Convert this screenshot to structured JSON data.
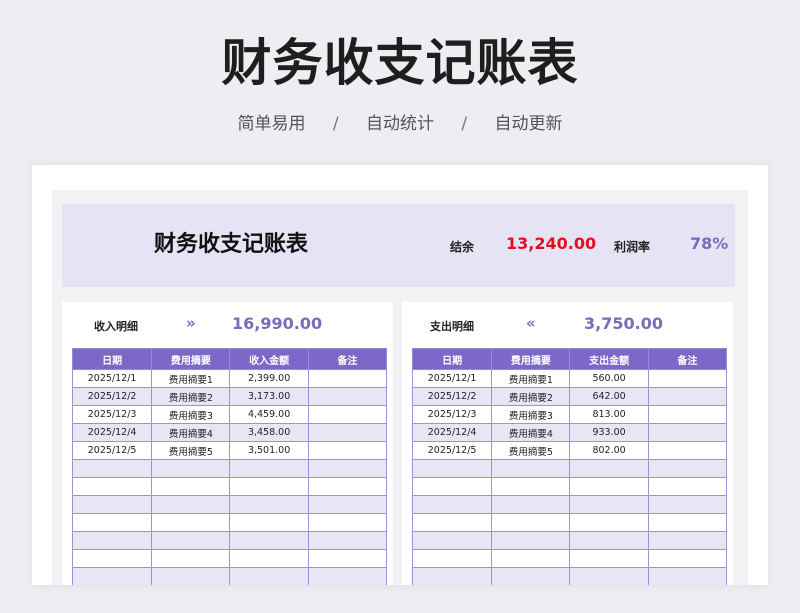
{
  "header": {
    "title": "财务收支记账表",
    "features": [
      "简单易用",
      "自动统计",
      "自动更新"
    ],
    "separator": "/"
  },
  "banner": {
    "title": "财务收支记账表",
    "balance_label": "结余",
    "balance_value": "13,240.00",
    "profit_label": "利润率",
    "profit_value": "78%"
  },
  "income": {
    "label": "收入明细",
    "arrow": "»",
    "total": "16,990.00",
    "columns": [
      "日期",
      "费用摘要",
      "收入金额",
      "备注"
    ],
    "rows": [
      [
        "2025/12/1",
        "费用摘要1",
        "2,399.00",
        ""
      ],
      [
        "2025/12/2",
        "费用摘要2",
        "3,173.00",
        ""
      ],
      [
        "2025/12/3",
        "费用摘要3",
        "4,459.00",
        ""
      ],
      [
        "2025/12/4",
        "费用摘要4",
        "3,458.00",
        ""
      ],
      [
        "2025/12/5",
        "费用摘要5",
        "3,501.00",
        ""
      ],
      [
        "",
        "",
        "",
        ""
      ],
      [
        "",
        "",
        "",
        ""
      ],
      [
        "",
        "",
        "",
        ""
      ],
      [
        "",
        "",
        "",
        ""
      ],
      [
        "",
        "",
        "",
        ""
      ],
      [
        "",
        "",
        "",
        ""
      ],
      [
        "",
        "",
        "",
        ""
      ],
      [
        "",
        "",
        "",
        ""
      ]
    ]
  },
  "expense": {
    "label": "支出明细",
    "arrow": "«",
    "total": "3,750.00",
    "columns": [
      "日期",
      "费用摘要",
      "支出金额",
      "备注"
    ],
    "rows": [
      [
        "2025/12/1",
        "费用摘要1",
        "560.00",
        ""
      ],
      [
        "2025/12/2",
        "费用摘要2",
        "642.00",
        ""
      ],
      [
        "2025/12/3",
        "费用摘要3",
        "813.00",
        ""
      ],
      [
        "2025/12/4",
        "费用摘要4",
        "933.00",
        ""
      ],
      [
        "2025/12/5",
        "费用摘要5",
        "802.00",
        ""
      ],
      [
        "",
        "",
        "",
        ""
      ],
      [
        "",
        "",
        "",
        ""
      ],
      [
        "",
        "",
        "",
        ""
      ],
      [
        "",
        "",
        "",
        ""
      ],
      [
        "",
        "",
        "",
        ""
      ],
      [
        "",
        "",
        "",
        ""
      ],
      [
        "",
        "",
        "",
        ""
      ],
      [
        "",
        "",
        "",
        ""
      ]
    ]
  },
  "colors": {
    "accent": "#7b68c8",
    "accent_text": "#7b6bbd",
    "balance_red": "#e01020",
    "banner_bg": "#e6e4f4",
    "row_alt": "#e8e6f6"
  }
}
